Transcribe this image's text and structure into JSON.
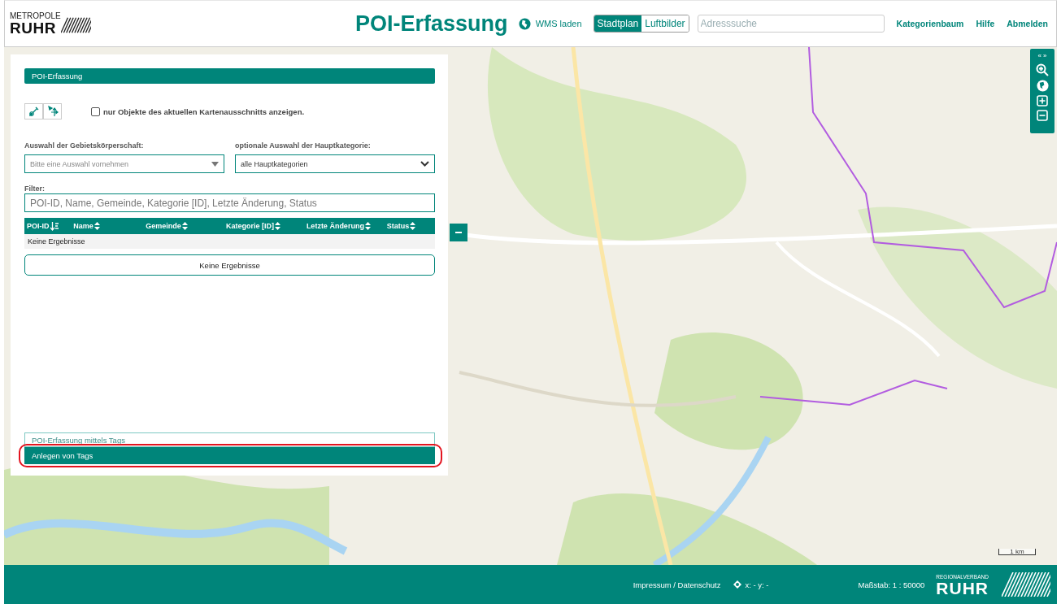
{
  "header": {
    "logo": {
      "small": "METROPOLE",
      "big": "RUHR"
    },
    "title": "POI-Erfassung",
    "wms": "WMS laden",
    "map_types": [
      {
        "label": "Stadtplan",
        "selected": true
      },
      {
        "label": "Luftbilder",
        "selected": false
      }
    ],
    "search": {
      "placeholder": "Adresssuche"
    },
    "links": [
      "Kategorienbaum",
      "Hilfe",
      "Abmelden"
    ]
  },
  "panel": {
    "title": "POI-Erfassung",
    "checkbox": {
      "label": "nur Objekte des aktuellen Kartenausschnitts anzeigen.",
      "checked": false
    },
    "selects": [
      {
        "kind": "combo",
        "label": "Auswahl der Gebietskörperschaft:",
        "placeholder": "Bitte eine Auswahl vornehmen"
      },
      {
        "kind": "native",
        "label": "optionale Auswahl der Hauptkategorie:",
        "value": "alle Hauptkategorien"
      }
    ],
    "filter": {
      "label": "Filter:",
      "placeholder": "POI-ID, Name, Gemeinde, Kategorie [ID], Letzte Änderung, Status"
    },
    "table": {
      "columns": [
        {
          "label": "POI-ID",
          "sorted": true
        },
        {
          "label": "Name",
          "sorted": false
        },
        {
          "label": "Gemeinde",
          "sorted": false
        },
        {
          "label": "Kategorie [ID]",
          "sorted": false
        },
        {
          "label": "Letzte Änderung",
          "sorted": false
        },
        {
          "label": "Status",
          "sorted": false
        }
      ],
      "empty": "Keine Ergebnisse"
    },
    "result_button": "Keine Ergebnisse",
    "sections": [
      {
        "title": "POI-Erfassung mittels Tags",
        "selected": false,
        "highlighted": false
      },
      {
        "title": "Anlegen von Tags",
        "selected": true,
        "highlighted": true
      }
    ]
  },
  "map_tools": {
    "toggle": "« »"
  },
  "scale_bar": "1 km",
  "footer": {
    "links": "Impressum / Datenschutz",
    "coords": "x: - y: -",
    "scale": "Maßstab: 1 : 50000",
    "logo": {
      "small": "REGIONALVERBAND",
      "big": "RUHR"
    }
  }
}
